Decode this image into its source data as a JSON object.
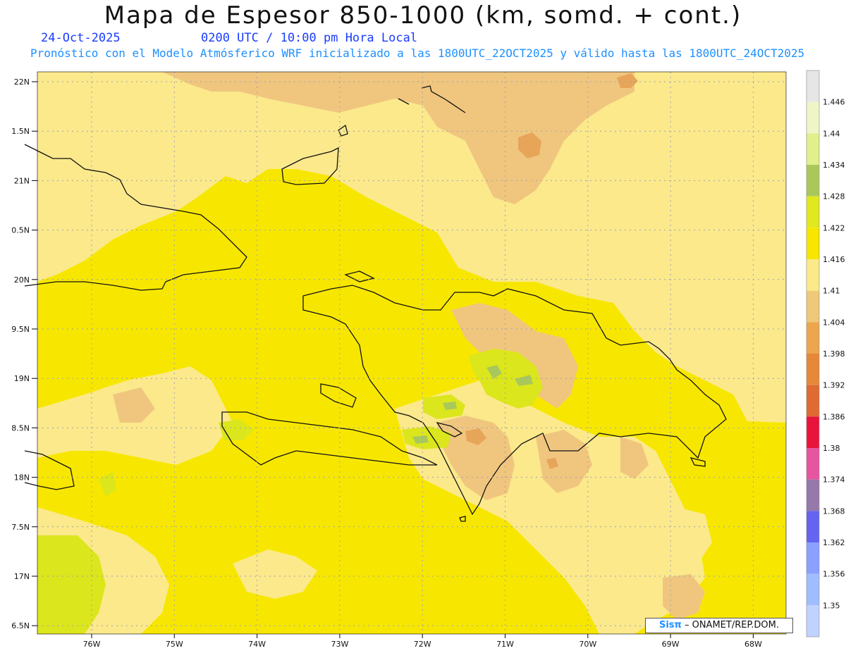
{
  "header": {
    "title": "Mapa de Espesor 850-1000 (km, somd. + cont.)",
    "date": "24-Oct-2025",
    "time": "0200 UTC / 10:00 pm Hora Local",
    "subtitle": "Pronóstico con el Modelo Atmósferico WRF inicializado a las 1800UTC_22OCT2025 y válido hasta las  1800UTC_24OCT2025"
  },
  "axes": {
    "lat_labels": [
      "22N",
      "1.5N",
      "21N",
      "0.5N",
      "20N",
      "9.5N",
      "19N",
      "8.5N",
      "18N",
      "7.5N",
      "17N",
      "6.5N"
    ],
    "lon_labels": [
      "76W",
      "75W",
      "74W",
      "73W",
      "72W",
      "71W",
      "70W",
      "69W",
      "68W"
    ]
  },
  "colorbar": {
    "labels": [
      "1.446",
      "1.44",
      "1.434",
      "1.428",
      "1.422",
      "1.416",
      "1.41",
      "1.404",
      "1.398",
      "1.392",
      "1.386",
      "1.38",
      "1.374",
      "1.368",
      "1.362",
      "1.356",
      "1.35"
    ],
    "colors": [
      "#e6e6e6",
      "#f0f5c8",
      "#e1f08c",
      "#aac85a",
      "#e0e81e",
      "#f8e600",
      "#fbe98a",
      "#f0c87a",
      "#eca64e",
      "#e6873a",
      "#df6a32",
      "#e8143c",
      "#e655a0",
      "#9678aa",
      "#6464f0",
      "#8ca0ff",
      "#a0beff",
      "#c0d2ff"
    ]
  },
  "map_colors": {
    "base_yellow": "#f7e700",
    "light_yellow": "#fbe98c",
    "tan": "#f0c67e",
    "orange": "#e7a55a",
    "green_yellow": "#dbe61c",
    "green": "#a9c85b",
    "coast": "#111111"
  },
  "credit": {
    "brand": "Sisπ",
    "org": "– ONAMET/REP.DOM."
  }
}
